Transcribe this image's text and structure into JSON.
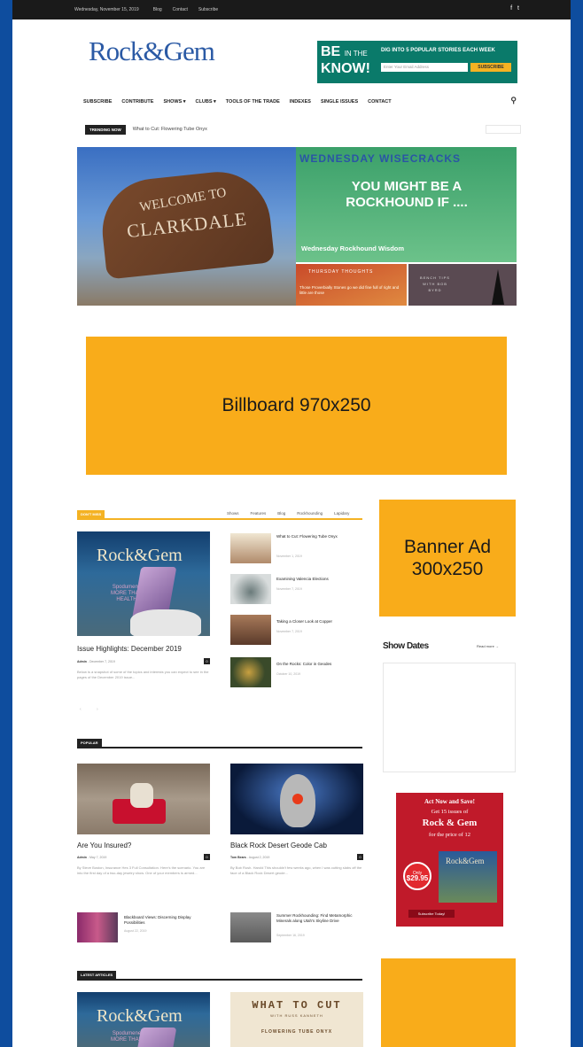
{
  "topbar": {
    "date": "Wednesday, November 15, 2019",
    "links": [
      "Blog",
      "Contact",
      "Subscribe"
    ],
    "social": [
      "f",
      "t"
    ]
  },
  "logo": {
    "rock": "Rock",
    "amp": "&",
    "gem": "Gem"
  },
  "newsletter": {
    "big1": "BE",
    "big_small": "IN THE",
    "big2": "KNOW!",
    "tagline": "DIG INTO 5 POPULAR STORIES EACH WEEK",
    "email_placeholder": "Enter Your Email Address",
    "button": "SUBSCRIBE"
  },
  "nav": {
    "items": [
      "SUBSCRIBE",
      "CONTRIBUTE",
      "SHOWS ▾",
      "CLUBS ▾",
      "TOOLS OF THE TRADE",
      "INDEXES",
      "SINGLE ISSUES",
      "CONTACT"
    ],
    "search_icon": "search-icon"
  },
  "trending": {
    "tag": "TRENDING NOW",
    "text": "What to Cut: Flowering Tube Onyx"
  },
  "hero": {
    "left": {
      "welcome": "WELCOME TO",
      "town": "CLARKDALE"
    },
    "right_top": {
      "kicker": "WEDNESDAY WISECRACKS",
      "headline": "YOU MIGHT BE A ROCKHOUND IF ....",
      "caption": "Wednesday Rockhound Wisdom"
    },
    "right_mid": {
      "kicker": "THURSDAY THOUGHTS",
      "text": "Those Proverbially Stones go we did fine full of right and little are those"
    },
    "right_end": {
      "text": "BENCH TIPS WITH BOB BYRD"
    }
  },
  "billboard": {
    "label": "Billboard 970x250"
  },
  "dont_miss": {
    "tab": "DON'T MISS",
    "filters": [
      "Shows",
      "Features",
      "Blog",
      "Rockhounding",
      "Lapidary"
    ],
    "main": {
      "cover_title": "Rock&Gem",
      "cover_sub": "Spodumene MORE THAN HEALTH",
      "title": "Issue Highlights: December 2019",
      "author": "Admin",
      "date": "December 7, 2019",
      "count": "0",
      "excerpt": "Below is a snapshot of some of the topics and interests you can expect to see in the pages of the December 2019 issue..."
    },
    "list": [
      {
        "title": "What to Cut: Flowering Tube Onyx",
        "date": "November 1, 2019"
      },
      {
        "title": "Examining Valencia Elections",
        "date": "November 7, 2019"
      },
      {
        "title": "Taking a Closer Look at Copper",
        "date": "November 7, 2019"
      },
      {
        "title": "On the Rocks: Color in Geodes",
        "date": "October 10, 2019"
      }
    ],
    "pager": "‹ ›"
  },
  "popular": {
    "tab": "POPULAR",
    "a": {
      "title": "Are You Insured?",
      "author": "Admin",
      "date": "May 7, 2019",
      "count": "0",
      "excerpt": "By Steve Boston, Insurance Hes 3 Full Consultation. Here's the scenario. You are into the first day of a two-day jewelry show. One of your members is armed..."
    },
    "b": {
      "title": "Black Rock Desert Geode Cab",
      "author": "Tom Bears",
      "date": "August 2, 2019",
      "count": "0",
      "excerpt": "By Bob Rush. Harold This shouldn't few weeks ago, when I was cutting slabs off the face of a Black Rock Desert geode..."
    },
    "list": [
      {
        "title": "Blackboard Views: Discerning Display Possibilities",
        "date": "August 22, 2019"
      },
      {
        "title": "Summer Rockhounding: Find Metamorphic Minerals along Utah's Skyline Drive",
        "date": "September 16, 2019"
      }
    ]
  },
  "sidebar": {
    "banner": "Banner Ad 300x250",
    "show_dates": "Show Dates",
    "read_more": "Read more →",
    "promo": {
      "l1": "Act Now and Save!",
      "l2": "Get 15 issues of",
      "l3": "Rock & Gem",
      "l4": "for the price of 12",
      "price_label": "Only",
      "price": "$29.95",
      "mini": "Rock&Gem",
      "cta": "Subscribe Today!"
    }
  },
  "latest": {
    "tab": "LATEST ARTICLES",
    "wtc": {
      "a": "WHAT TO CUT",
      "b": "WITH\nRUSS KANNETH",
      "c": "FLOWERING TUBE ONYX"
    },
    "cover_title": "Rock&Gem",
    "cover_sub": "Spodumene MORE THAN"
  }
}
